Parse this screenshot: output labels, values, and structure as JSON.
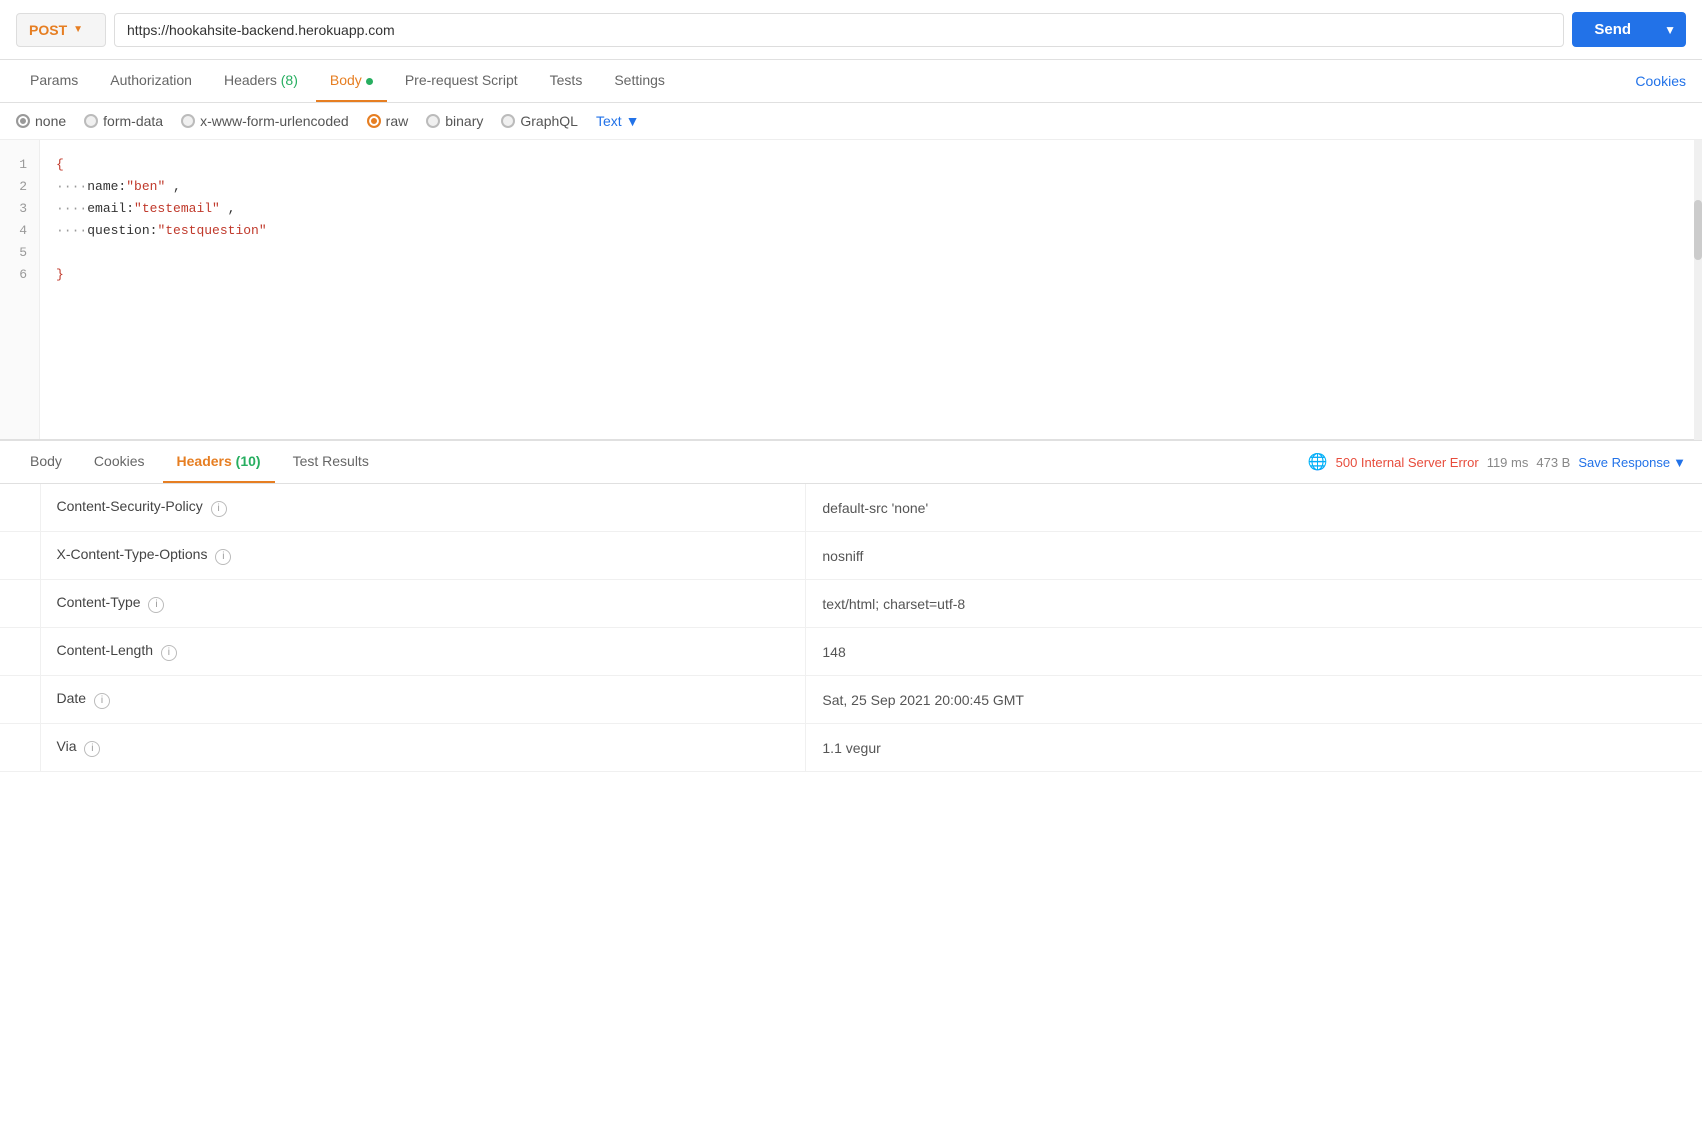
{
  "topbar": {
    "method": "POST",
    "url": "https://hookahsite-backend.herokuapp.com",
    "send_label": "Send"
  },
  "tabs": {
    "items": [
      {
        "id": "params",
        "label": "Params",
        "active": false,
        "count": null,
        "dot": false
      },
      {
        "id": "authorization",
        "label": "Authorization",
        "active": false,
        "count": null,
        "dot": false
      },
      {
        "id": "headers",
        "label": "Headers",
        "active": false,
        "count": "(8)",
        "dot": false
      },
      {
        "id": "body",
        "label": "Body",
        "active": true,
        "count": null,
        "dot": true
      },
      {
        "id": "pre-request-script",
        "label": "Pre-request Script",
        "active": false,
        "count": null,
        "dot": false
      },
      {
        "id": "tests",
        "label": "Tests",
        "active": false,
        "count": null,
        "dot": false
      },
      {
        "id": "settings",
        "label": "Settings",
        "active": false,
        "count": null,
        "dot": false
      }
    ],
    "cookies_label": "Cookies"
  },
  "body_options": {
    "none": "none",
    "form_data": "form-data",
    "urlencoded": "x-www-form-urlencoded",
    "raw": "raw",
    "binary": "binary",
    "graphql": "GraphQL",
    "text_label": "Text"
  },
  "editor": {
    "lines": [
      {
        "num": 1,
        "content": "{"
      },
      {
        "num": 2,
        "content": "    name:\"ben\" ,"
      },
      {
        "num": 3,
        "content": "    email:\"testemail\" ,"
      },
      {
        "num": 4,
        "content": "    question:\"testquestion\""
      },
      {
        "num": 5,
        "content": ""
      },
      {
        "num": 6,
        "content": "}"
      }
    ]
  },
  "response": {
    "tabs": [
      {
        "id": "body",
        "label": "Body",
        "active": false
      },
      {
        "id": "cookies",
        "label": "Cookies",
        "active": false
      },
      {
        "id": "headers",
        "label": "Headers",
        "active": true,
        "count": "(10)"
      },
      {
        "id": "test-results",
        "label": "Test Results",
        "active": false
      }
    ],
    "status": "500 Internal Server Error",
    "time": "119 ms",
    "size": "473 B",
    "save_response_label": "Save Response",
    "headers": [
      {
        "name": "Content-Security-Policy",
        "value": "default-src 'none'"
      },
      {
        "name": "X-Content-Type-Options",
        "value": "nosniff"
      },
      {
        "name": "Content-Type",
        "value": "text/html; charset=utf-8"
      },
      {
        "name": "Content-Length",
        "value": "148"
      },
      {
        "name": "Date",
        "value": "Sat, 25 Sep 2021 20:00:45 GMT"
      },
      {
        "name": "Via",
        "value": "1.1 vegur"
      }
    ]
  }
}
